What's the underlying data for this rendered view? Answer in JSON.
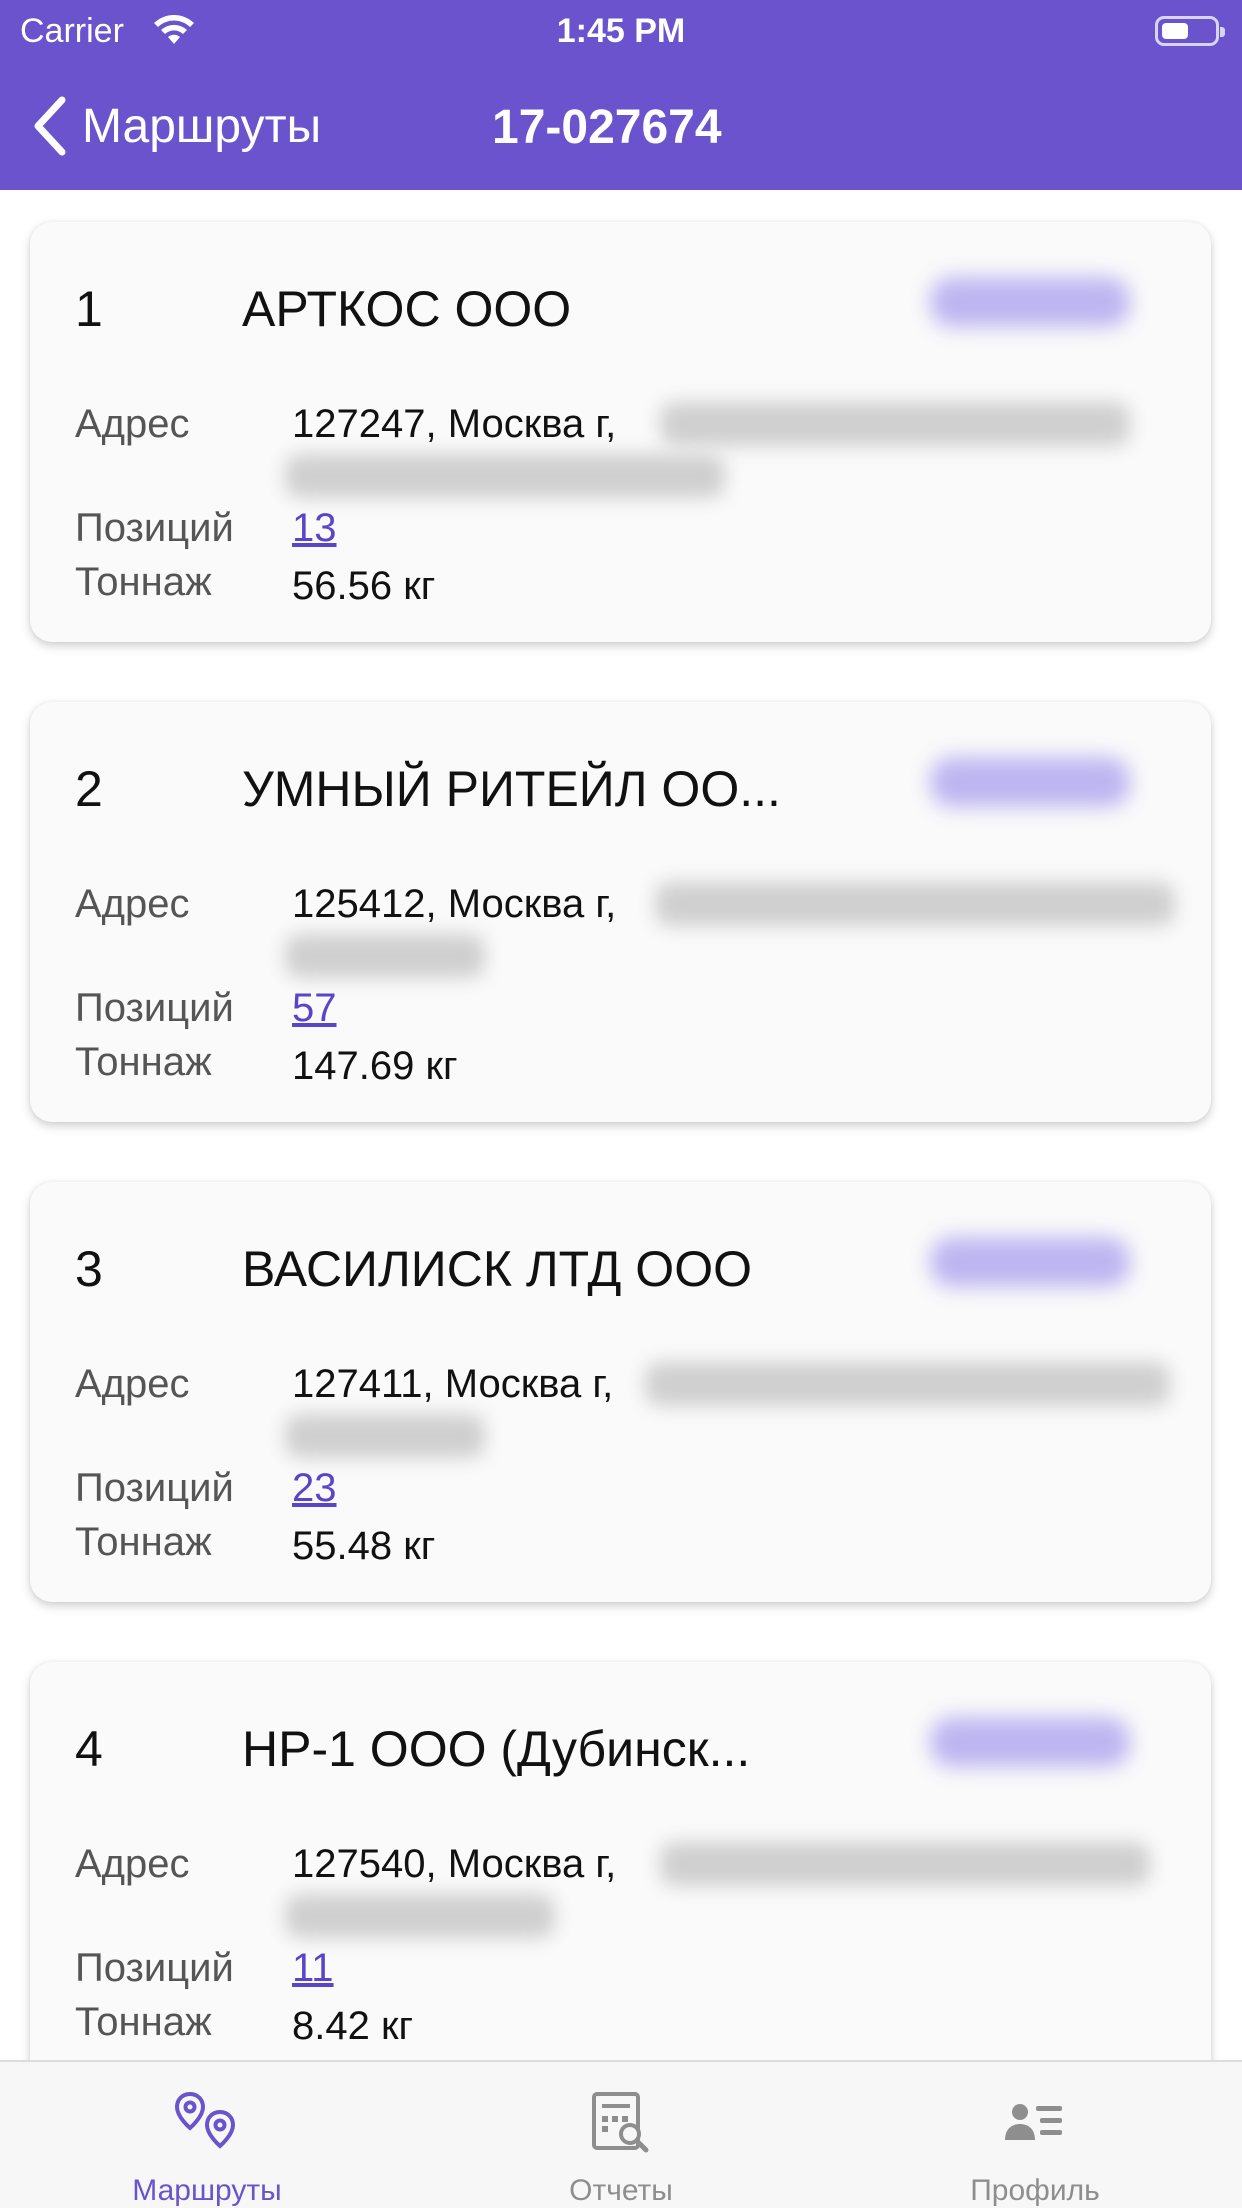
{
  "status_bar": {
    "carrier": "Carrier",
    "time": "1:45 PM"
  },
  "nav": {
    "back_label": "Маршруты",
    "title": "17-027674"
  },
  "labels": {
    "address": "Адрес",
    "positions": "Позиций",
    "tonnage": "Тоннаж"
  },
  "stops": [
    {
      "number": "1",
      "name": "АРТКОС ООО",
      "address": "127247, Москва г,",
      "positions": "13",
      "tonnage": "56.56 кг"
    },
    {
      "number": "2",
      "name": "УМНЫЙ РИТЕЙЛ ОО...",
      "address": "125412, Москва г,",
      "positions": "57",
      "tonnage": "147.69 кг"
    },
    {
      "number": "3",
      "name": "ВАСИЛИСК ЛТД ООО",
      "address": "127411, Москва г,",
      "positions": "23",
      "tonnage": "55.48 кг"
    },
    {
      "number": "4",
      "name": "НР-1 ООО (Дубинск...",
      "address": "127540, Москва г,",
      "positions": "11",
      "tonnage": "8.42 кг"
    }
  ],
  "tabs": [
    {
      "label": "Маршруты",
      "icon": "route-pins-icon",
      "active": true
    },
    {
      "label": "Отчеты",
      "icon": "report-icon",
      "active": false
    },
    {
      "label": "Профиль",
      "icon": "profile-icon",
      "active": false
    }
  ],
  "colors": {
    "accent": "#6a53cc",
    "link": "#5a44c9",
    "inactive": "#8e8e8e"
  }
}
